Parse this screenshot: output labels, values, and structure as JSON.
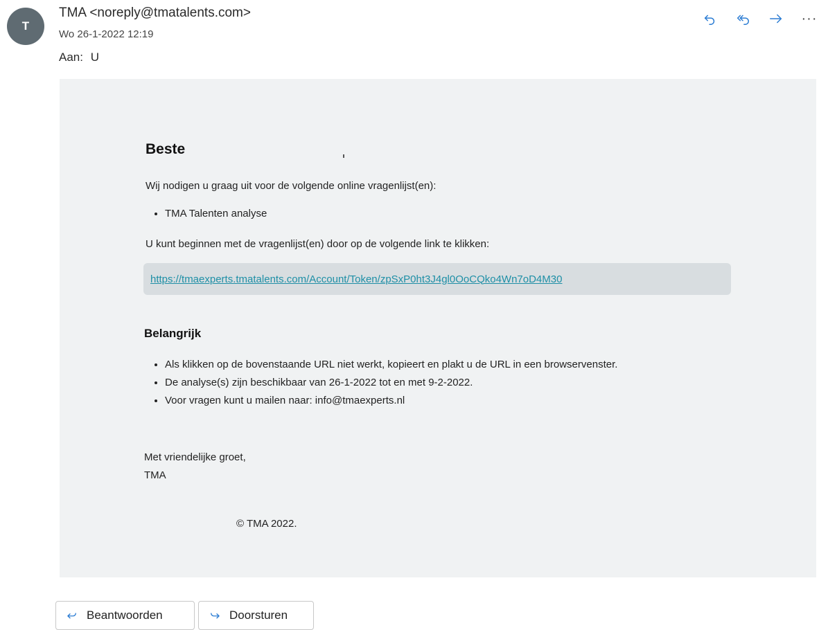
{
  "header": {
    "avatar_initial": "T",
    "sender": "TMA <noreply@tmatalents.com>",
    "date": "Wo 26-1-2022 12:19",
    "to_label": "Aan:",
    "to_value": "U",
    "more_label": "···"
  },
  "message": {
    "greeting": "Beste",
    "intro": "Wij nodigen u graag uit voor de volgende online vragenlijst(en):",
    "questionnaires": [
      "TMA Talenten analyse"
    ],
    "instruction": "U kunt beginnen met de vragenlijst(en) door op de volgende link te klikken:",
    "link": "https://tmaexperts.tmatalents.com/Account/Token/zpSxP0ht3J4gl0OoCQko4Wn7oD4M30",
    "important_heading": "Belangrijk",
    "important_items": [
      "Als klikken op de bovenstaande URL niet werkt, kopieert en plakt u de URL in een browservenster.",
      "De analyse(s) zijn beschikbaar van 26-1-2022 tot en met 9-2-2022.",
      "Voor vragen kunt u mailen naar: info@tmaexperts.nl"
    ],
    "closing_line1": "Met vriendelijke groet,",
    "closing_line2": "TMA",
    "copyright": "© TMA 2022."
  },
  "footer": {
    "reply_label": "Beantwoorden",
    "forward_label": "Doorsturen"
  },
  "colors": {
    "accent": "#2b7cd3",
    "link": "#1e8fa6",
    "panel_bg": "#f0f2f3",
    "link_box_bg": "#d8dde0"
  }
}
